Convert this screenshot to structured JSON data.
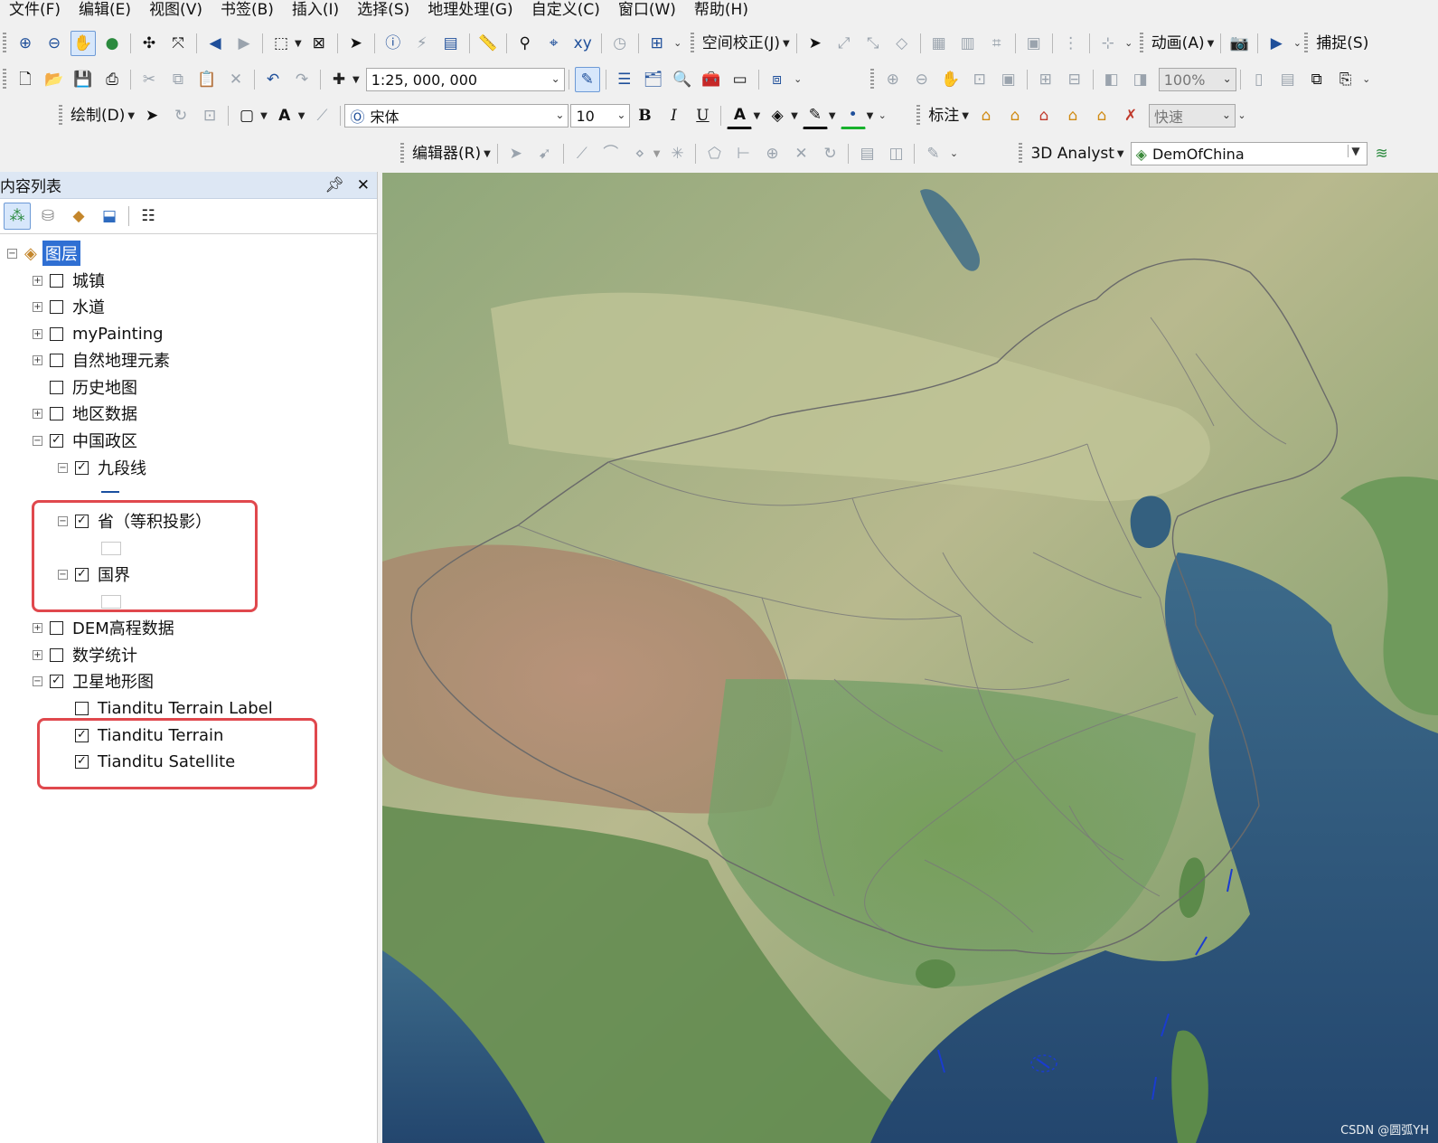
{
  "menu": [
    "文件(F)",
    "编辑(E)",
    "视图(V)",
    "书签(B)",
    "插入(I)",
    "选择(S)",
    "地理处理(G)",
    "自定义(C)",
    "窗口(W)",
    "帮助(H)"
  ],
  "toolbar": {
    "spatial_adjust": "空间校正(J)",
    "animation": "动画(A)",
    "snapping": "捕捉(S)",
    "scale": "1:25, 000, 000",
    "zoom_percent": "100%",
    "drawing": "绘制(D)",
    "font_name": "宋体",
    "font_size": "10",
    "bold": "B",
    "italic": "I",
    "underline": "U",
    "font_color_letter": "A",
    "labeling": "标注",
    "quick": "快速",
    "editor": "编辑器(R)",
    "analyst": "3D Analyst",
    "analyst_layer": "DemOfChina"
  },
  "toc": {
    "title": "内容列表",
    "root": "图层",
    "layers": {
      "cz": {
        "label": "城镇",
        "checked": false
      },
      "sd": {
        "label": "水道",
        "checked": false
      },
      "mp": {
        "label": "myPainting",
        "checked": false
      },
      "zr": {
        "label": "自然地理元素",
        "checked": false
      },
      "ls": {
        "label": "历史地图",
        "checked": false
      },
      "dq": {
        "label": "地区数据",
        "checked": false
      },
      "zg": {
        "label": "中国政区",
        "checked": true
      },
      "jd": {
        "label": "九段线",
        "checked": true
      },
      "sh": {
        "label": "省（等积投影）",
        "checked": true
      },
      "gj": {
        "label": "国界",
        "checked": true
      },
      "dem": {
        "label": "DEM高程数据",
        "checked": false
      },
      "sx": {
        "label": "数学统计",
        "checked": false
      },
      "wx": {
        "label": "卫星地形图",
        "checked": true
      },
      "tl": {
        "label": "Tianditu Terrain Label",
        "checked": false
      },
      "tt": {
        "label": "Tianditu Terrain",
        "checked": true
      },
      "ts": {
        "label": "Tianditu Satellite",
        "checked": true
      }
    }
  },
  "watermark": "CSDN @圆弧YH",
  "colors": {
    "highlight_box": "#e0484d",
    "selected_root": "#2f6fd3",
    "toc_header": "#dde7f4"
  }
}
